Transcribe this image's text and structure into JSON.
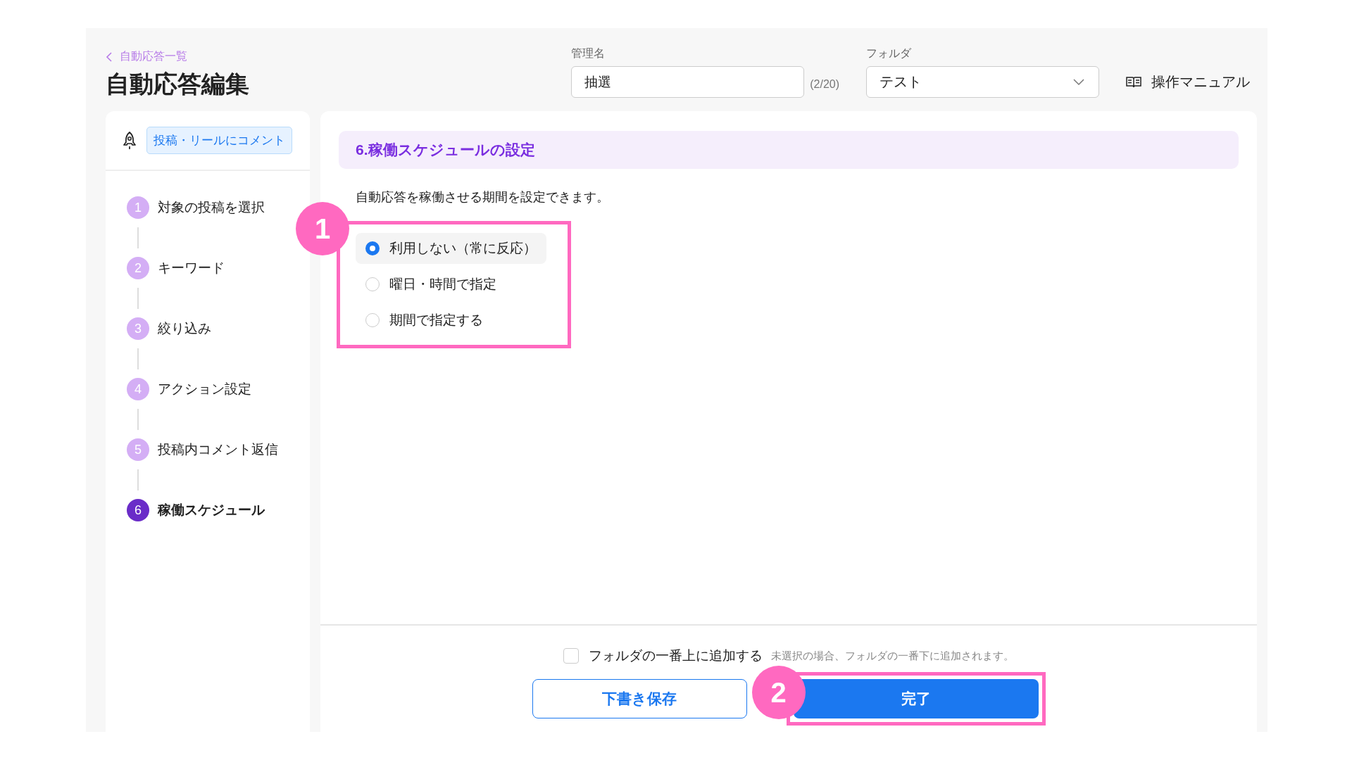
{
  "header": {
    "back_link": "自動応答一覧",
    "title": "自動応答編集",
    "name_field": {
      "label": "管理名",
      "value": "抽選",
      "counter": "(2/20)"
    },
    "folder_field": {
      "label": "フォルダ",
      "value": "テスト"
    },
    "manual_link": "操作マニュアル"
  },
  "sidebar": {
    "trigger_tag": "投稿・リールにコメント",
    "steps": [
      {
        "number": "1",
        "label": "対象の投稿を選択",
        "selected": false
      },
      {
        "number": "2",
        "label": "キーワード",
        "selected": false
      },
      {
        "number": "3",
        "label": "絞り込み",
        "selected": false
      },
      {
        "number": "4",
        "label": "アクション設定",
        "selected": false
      },
      {
        "number": "5",
        "label": "投稿内コメント返信",
        "selected": false
      },
      {
        "number": "6",
        "label": "稼働スケジュール",
        "selected": true
      }
    ]
  },
  "section": {
    "title": "6.稼働スケジュールの設定",
    "description": "自動応答を稼働させる期間を設定できます。",
    "options": [
      {
        "label": "利用しない（常に反応）",
        "selected": true
      },
      {
        "label": "曜日・時間で指定",
        "selected": false
      },
      {
        "label": "期間で指定する",
        "selected": false
      }
    ]
  },
  "footer": {
    "checkbox": {
      "label": "フォルダの一番上に追加する",
      "checked": false,
      "hint": "未選択の場合、フォルダの一番下に追加されます。"
    },
    "buttons": [
      {
        "label": "下書き保存",
        "kind": "secondary"
      },
      {
        "label": "完了",
        "kind": "primary"
      }
    ]
  },
  "annotations": [
    {
      "number": "1"
    },
    {
      "number": "2"
    }
  ]
}
